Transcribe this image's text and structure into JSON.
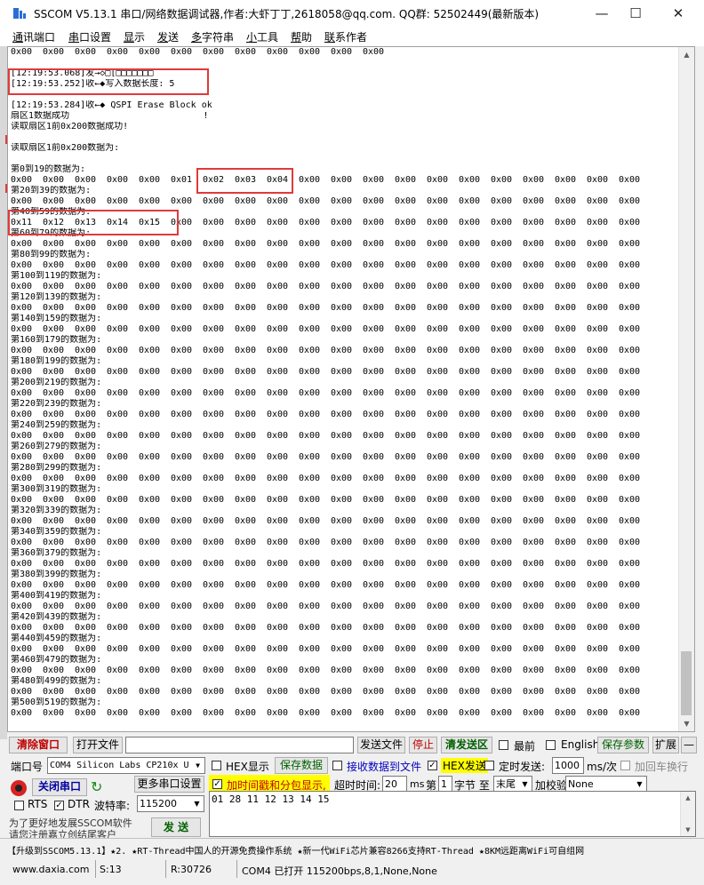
{
  "window": {
    "title": "SSCOM V5.13.1 串口/网络数据调试器,作者:大虾丁丁,2618058@qq.com. QQ群: 52502449(最新版本)",
    "minimize": "—",
    "maximize": "☐",
    "close": "✕"
  },
  "menu": [
    {
      "u": "通",
      "rest": "讯端口"
    },
    {
      "u": "串",
      "rest": "口设置"
    },
    {
      "u": "显",
      "rest": "示"
    },
    {
      "u": "发",
      "rest": "送"
    },
    {
      "u": "多",
      "rest": "字符串"
    },
    {
      "u": "小",
      "rest": "工具"
    },
    {
      "u": "帮",
      "rest": "助"
    },
    {
      "u": "联",
      "rest": "系作者"
    }
  ],
  "log": {
    "top_row": [
      "0x00",
      "0x00",
      "0x00",
      "0x00",
      "0x00",
      "0x00",
      "0x00",
      "0x00",
      "0x00",
      "0x00",
      "0x00",
      "0x00"
    ],
    "lines": [
      "",
      "[12:19:53.068]发→◇□[□□□□□□□",
      "[12:19:53.252]收←◆写入数据长度: 5",
      "",
      "[12:19:53.284]收←◆ QSPI Erase Block ok",
      "扇区1数据成功                         !",
      "读取扇区1前0x200数据成功!",
      "",
      "读取扇区1前0x200数据为:",
      ""
    ],
    "blocks": [
      {
        "label": "第0到19的数据为:",
        "values": [
          "0x00",
          "0x00",
          "0x00",
          "0x00",
          "0x00",
          "0x01",
          "0x02",
          "0x03",
          "0x04",
          "0x00",
          "0x00",
          "0x00",
          "0x00",
          "0x00",
          "0x00",
          "0x00",
          "0x00",
          "0x00",
          "0x00",
          "0x00"
        ]
      },
      {
        "label": "第20到39的数据为:",
        "values": [
          "0x00",
          "0x00",
          "0x00",
          "0x00",
          "0x00",
          "0x00",
          "0x00",
          "0x00",
          "0x00",
          "0x00",
          "0x00",
          "0x00",
          "0x00",
          "0x00",
          "0x00",
          "0x00",
          "0x00",
          "0x00",
          "0x00",
          "0x00"
        ]
      },
      {
        "label": "第40到59的数据为:",
        "values": [
          "0x11",
          "0x12",
          "0x13",
          "0x14",
          "0x15",
          "0x00",
          "0x00",
          "0x00",
          "0x00",
          "0x00",
          "0x00",
          "0x00",
          "0x00",
          "0x00",
          "0x00",
          "0x00",
          "0x00",
          "0x00",
          "0x00",
          "0x00"
        ]
      },
      {
        "label": "第60到79的数据为:",
        "values": [
          "0x00",
          "0x00",
          "0x00",
          "0x00",
          "0x00",
          "0x00",
          "0x00",
          "0x00",
          "0x00",
          "0x00",
          "0x00",
          "0x00",
          "0x00",
          "0x00",
          "0x00",
          "0x00",
          "0x00",
          "0x00",
          "0x00",
          "0x00"
        ]
      },
      {
        "label": "第80到99的数据为:",
        "values": [
          "0x00",
          "0x00",
          "0x00",
          "0x00",
          "0x00",
          "0x00",
          "0x00",
          "0x00",
          "0x00",
          "0x00",
          "0x00",
          "0x00",
          "0x00",
          "0x00",
          "0x00",
          "0x00",
          "0x00",
          "0x00",
          "0x00",
          "0x00"
        ]
      },
      {
        "label": "第100到119的数据为:",
        "values": [
          "0x00",
          "0x00",
          "0x00",
          "0x00",
          "0x00",
          "0x00",
          "0x00",
          "0x00",
          "0x00",
          "0x00",
          "0x00",
          "0x00",
          "0x00",
          "0x00",
          "0x00",
          "0x00",
          "0x00",
          "0x00",
          "0x00",
          "0x00"
        ]
      },
      {
        "label": "第120到139的数据为:",
        "values": [
          "0x00",
          "0x00",
          "0x00",
          "0x00",
          "0x00",
          "0x00",
          "0x00",
          "0x00",
          "0x00",
          "0x00",
          "0x00",
          "0x00",
          "0x00",
          "0x00",
          "0x00",
          "0x00",
          "0x00",
          "0x00",
          "0x00",
          "0x00"
        ]
      },
      {
        "label": "第140到159的数据为:",
        "values": [
          "0x00",
          "0x00",
          "0x00",
          "0x00",
          "0x00",
          "0x00",
          "0x00",
          "0x00",
          "0x00",
          "0x00",
          "0x00",
          "0x00",
          "0x00",
          "0x00",
          "0x00",
          "0x00",
          "0x00",
          "0x00",
          "0x00",
          "0x00"
        ]
      },
      {
        "label": "第160到179的数据为:",
        "values": [
          "0x00",
          "0x00",
          "0x00",
          "0x00",
          "0x00",
          "0x00",
          "0x00",
          "0x00",
          "0x00",
          "0x00",
          "0x00",
          "0x00",
          "0x00",
          "0x00",
          "0x00",
          "0x00",
          "0x00",
          "0x00",
          "0x00",
          "0x00"
        ]
      },
      {
        "label": "第180到199的数据为:",
        "values": [
          "0x00",
          "0x00",
          "0x00",
          "0x00",
          "0x00",
          "0x00",
          "0x00",
          "0x00",
          "0x00",
          "0x00",
          "0x00",
          "0x00",
          "0x00",
          "0x00",
          "0x00",
          "0x00",
          "0x00",
          "0x00",
          "0x00",
          "0x00"
        ]
      },
      {
        "label": "第200到219的数据为:",
        "values": [
          "0x00",
          "0x00",
          "0x00",
          "0x00",
          "0x00",
          "0x00",
          "0x00",
          "0x00",
          "0x00",
          "0x00",
          "0x00",
          "0x00",
          "0x00",
          "0x00",
          "0x00",
          "0x00",
          "0x00",
          "0x00",
          "0x00",
          "0x00"
        ]
      },
      {
        "label": "第220到239的数据为:",
        "values": [
          "0x00",
          "0x00",
          "0x00",
          "0x00",
          "0x00",
          "0x00",
          "0x00",
          "0x00",
          "0x00",
          "0x00",
          "0x00",
          "0x00",
          "0x00",
          "0x00",
          "0x00",
          "0x00",
          "0x00",
          "0x00",
          "0x00",
          "0x00"
        ]
      },
      {
        "label": "第240到259的数据为:",
        "values": [
          "0x00",
          "0x00",
          "0x00",
          "0x00",
          "0x00",
          "0x00",
          "0x00",
          "0x00",
          "0x00",
          "0x00",
          "0x00",
          "0x00",
          "0x00",
          "0x00",
          "0x00",
          "0x00",
          "0x00",
          "0x00",
          "0x00",
          "0x00"
        ]
      },
      {
        "label": "第260到279的数据为:",
        "values": [
          "0x00",
          "0x00",
          "0x00",
          "0x00",
          "0x00",
          "0x00",
          "0x00",
          "0x00",
          "0x00",
          "0x00",
          "0x00",
          "0x00",
          "0x00",
          "0x00",
          "0x00",
          "0x00",
          "0x00",
          "0x00",
          "0x00",
          "0x00"
        ]
      },
      {
        "label": "第280到299的数据为:",
        "values": [
          "0x00",
          "0x00",
          "0x00",
          "0x00",
          "0x00",
          "0x00",
          "0x00",
          "0x00",
          "0x00",
          "0x00",
          "0x00",
          "0x00",
          "0x00",
          "0x00",
          "0x00",
          "0x00",
          "0x00",
          "0x00",
          "0x00",
          "0x00"
        ]
      },
      {
        "label": "第300到319的数据为:",
        "values": [
          "0x00",
          "0x00",
          "0x00",
          "0x00",
          "0x00",
          "0x00",
          "0x00",
          "0x00",
          "0x00",
          "0x00",
          "0x00",
          "0x00",
          "0x00",
          "0x00",
          "0x00",
          "0x00",
          "0x00",
          "0x00",
          "0x00",
          "0x00"
        ]
      },
      {
        "label": "第320到339的数据为:",
        "values": [
          "0x00",
          "0x00",
          "0x00",
          "0x00",
          "0x00",
          "0x00",
          "0x00",
          "0x00",
          "0x00",
          "0x00",
          "0x00",
          "0x00",
          "0x00",
          "0x00",
          "0x00",
          "0x00",
          "0x00",
          "0x00",
          "0x00",
          "0x00"
        ]
      },
      {
        "label": "第340到359的数据为:",
        "values": [
          "0x00",
          "0x00",
          "0x00",
          "0x00",
          "0x00",
          "0x00",
          "0x00",
          "0x00",
          "0x00",
          "0x00",
          "0x00",
          "0x00",
          "0x00",
          "0x00",
          "0x00",
          "0x00",
          "0x00",
          "0x00",
          "0x00",
          "0x00"
        ]
      },
      {
        "label": "第360到379的数据为:",
        "values": [
          "0x00",
          "0x00",
          "0x00",
          "0x00",
          "0x00",
          "0x00",
          "0x00",
          "0x00",
          "0x00",
          "0x00",
          "0x00",
          "0x00",
          "0x00",
          "0x00",
          "0x00",
          "0x00",
          "0x00",
          "0x00",
          "0x00",
          "0x00"
        ]
      },
      {
        "label": "第380到399的数据为:",
        "values": [
          "0x00",
          "0x00",
          "0x00",
          "0x00",
          "0x00",
          "0x00",
          "0x00",
          "0x00",
          "0x00",
          "0x00",
          "0x00",
          "0x00",
          "0x00",
          "0x00",
          "0x00",
          "0x00",
          "0x00",
          "0x00",
          "0x00",
          "0x00"
        ]
      },
      {
        "label": "第400到419的数据为:",
        "values": [
          "0x00",
          "0x00",
          "0x00",
          "0x00",
          "0x00",
          "0x00",
          "0x00",
          "0x00",
          "0x00",
          "0x00",
          "0x00",
          "0x00",
          "0x00",
          "0x00",
          "0x00",
          "0x00",
          "0x00",
          "0x00",
          "0x00",
          "0x00"
        ]
      },
      {
        "label": "第420到439的数据为:",
        "values": [
          "0x00",
          "0x00",
          "0x00",
          "0x00",
          "0x00",
          "0x00",
          "0x00",
          "0x00",
          "0x00",
          "0x00",
          "0x00",
          "0x00",
          "0x00",
          "0x00",
          "0x00",
          "0x00",
          "0x00",
          "0x00",
          "0x00",
          "0x00"
        ]
      },
      {
        "label": "第440到459的数据为:",
        "values": [
          "0x00",
          "0x00",
          "0x00",
          "0x00",
          "0x00",
          "0x00",
          "0x00",
          "0x00",
          "0x00",
          "0x00",
          "0x00",
          "0x00",
          "0x00",
          "0x00",
          "0x00",
          "0x00",
          "0x00",
          "0x00",
          "0x00",
          "0x00"
        ]
      },
      {
        "label": "第460到479的数据为:",
        "values": [
          "0x00",
          "0x00",
          "0x00",
          "0x00",
          "0x00",
          "0x00",
          "0x00",
          "0x00",
          "0x00",
          "0x00",
          "0x00",
          "0x00",
          "0x00",
          "0x00",
          "0x00",
          "0x00",
          "0x00",
          "0x00",
          "0x00",
          "0x00"
        ]
      },
      {
        "label": "第480到499的数据为:",
        "values": [
          "0x00",
          "0x00",
          "0x00",
          "0x00",
          "0x00",
          "0x00",
          "0x00",
          "0x00",
          "0x00",
          "0x00",
          "0x00",
          "0x00",
          "0x00",
          "0x00",
          "0x00",
          "0x00",
          "0x00",
          "0x00",
          "0x00",
          "0x00"
        ]
      },
      {
        "label": "第500到519的数据为:",
        "values": [
          "0x00",
          "0x00",
          "0x00",
          "0x00",
          "0x00",
          "0x00",
          "0x00",
          "0x00",
          "0x00",
          "0x00",
          "0x00",
          "0x00",
          "0x00",
          "0x00",
          "0x00",
          "0x00",
          "0x00",
          "0x00",
          "0x00",
          "0x00"
        ]
      }
    ]
  },
  "toolbar": {
    "clear_window": "清除窗口",
    "open_file": "打开文件",
    "send_file": "发送文件",
    "stop": "停止",
    "clear_send": "清发送区",
    "topmost": "最前",
    "english": "English",
    "save_params": "保存参数",
    "expand": "扩展",
    "collapse": "—"
  },
  "port": {
    "port_label": "端口号",
    "port_value": "COM4 Silicon Labs CP210x U",
    "hex_display": "HEX显示",
    "save_data": "保存数据",
    "recv_to_file": "接收数据到文件",
    "hex_send": "HEX发送",
    "timed_send": "定时发送:",
    "interval": "1000",
    "interval_unit": "ms/次",
    "add_enter": "加回车换行",
    "close_port": "关闭串口",
    "more_settings": "更多串口设置",
    "timestamp": "加时间戳和分包显示,",
    "timeout_label": "超时时间:",
    "timeout_value": "20",
    "timeout_unit": "ms",
    "frame_prefix": "第",
    "frame_value": "1",
    "byte_to": "字节 至",
    "end_value": "末尾",
    "checksum_label": "加校验",
    "checksum_value": "None",
    "rts": "RTS",
    "dtr": "DTR",
    "baud_label": "波特率:",
    "baud_value": "115200",
    "send_content": "01 28 11 12 13 14 15",
    "send_button": "发 送",
    "promo_1": "为了更好地发展SSCOM软件",
    "promo_2": "请您注册嘉立创结尾客户"
  },
  "status": {
    "ticker": "【升级到SSCOM5.13.1】★2. ★RT-Thread中国人的开源免费操作系统 ★新一代WiFi芯片兼容8266支持RT-Thread ★8KM远距离WiFi可自组网",
    "website": "www.daxia.com",
    "sent": "S:13",
    "received": "R:30726",
    "port_state": "COM4 已打开  115200bps,8,1,None,None"
  }
}
